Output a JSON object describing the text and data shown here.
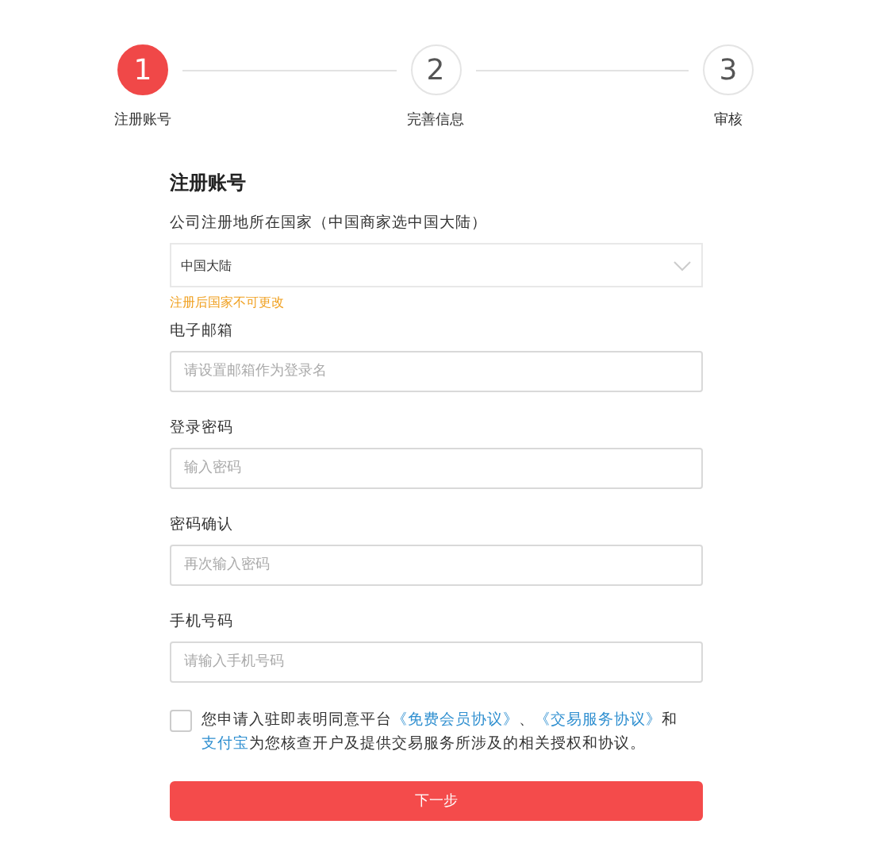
{
  "steps": [
    {
      "number": "1",
      "label": "注册账号",
      "selected": true
    },
    {
      "number": "2",
      "label": "完善信息",
      "selected": false
    },
    {
      "number": "3",
      "label": "审核",
      "selected": false
    }
  ],
  "form": {
    "title": "注册账号",
    "country": {
      "label": "公司注册地所在国家（中国商家选中国大陆）",
      "value": "中国大陆",
      "hint": "注册后国家不可更改"
    },
    "fields": [
      {
        "label": "电子邮箱",
        "placeholder": "请设置邮箱作为登录名"
      },
      {
        "label": "登录密码",
        "placeholder": "输入密码"
      },
      {
        "label": "密码确认",
        "placeholder": "再次输入密码"
      },
      {
        "label": "手机号码",
        "placeholder": "请输入手机号码"
      }
    ],
    "agreement": {
      "checked": false,
      "segments": [
        {
          "kind": "text",
          "text": "您申请入驻即表明同意平台"
        },
        {
          "kind": "link",
          "text": "《免费会员协议》"
        },
        {
          "kind": "text",
          "text": "、"
        },
        {
          "kind": "link",
          "text": "《交易服务协议》"
        },
        {
          "kind": "text",
          "text": "和"
        },
        {
          "kind": "link",
          "text": "支付宝"
        },
        {
          "kind": "text",
          "text": "为您核查开户及提供交易服务所涉及的相关授权和协议。"
        }
      ]
    },
    "submit": "下一步"
  }
}
